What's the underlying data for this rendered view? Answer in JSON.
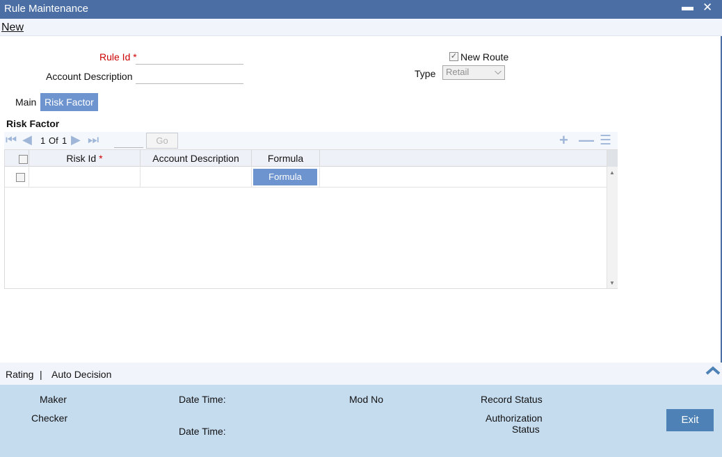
{
  "window": {
    "title": "Rule Maintenance",
    "minimize_glyph": "▬",
    "close_glyph": "✕"
  },
  "menu": {
    "new_label": "New"
  },
  "form": {
    "rule_id_label": "Rule Id",
    "required_mark": "*",
    "rule_id_value": "",
    "account_description_label": "Account Description",
    "account_description_value": "",
    "new_route_label": "New Route",
    "new_route_checked": true,
    "type_label": "Type",
    "type_value": "Retail"
  },
  "tabs": [
    {
      "label": "Main",
      "active": false
    },
    {
      "label": "Risk Factor",
      "active": true
    }
  ],
  "risk_factor": {
    "section_title": "Risk Factor",
    "pager": {
      "current": "1",
      "of_label": "Of",
      "total": "1",
      "go_label": "Go",
      "page_input": ""
    },
    "columns": [
      "Risk Id",
      "Account Description",
      "Formula"
    ],
    "rows": [
      {
        "risk_id": "",
        "account_description": "",
        "formula_button": "Formula"
      }
    ]
  },
  "subfooter": {
    "rating_label": "Rating",
    "separator": "|",
    "auto_decision_label": "Auto Decision"
  },
  "footer": {
    "maker_label": "Maker",
    "checker_label": "Checker",
    "date_time_label_1": "Date Time:",
    "date_time_label_2": "Date Time:",
    "mod_no_label": "Mod No",
    "record_status_label": "Record Status",
    "authorization_label": "Authorization",
    "status_label": "Status",
    "exit_label": "Exit"
  },
  "colors": {
    "titlebar": "#4b6fa5",
    "accent": "#6d94cf",
    "footer": "#c5dbee",
    "exit_button": "#4e82b7",
    "required": "#cc0000"
  },
  "icons": [
    "first-page-icon",
    "prev-page-icon",
    "next-page-icon",
    "last-page-icon",
    "add-row-icon",
    "delete-row-icon",
    "single-view-icon",
    "collapse-icon"
  ]
}
